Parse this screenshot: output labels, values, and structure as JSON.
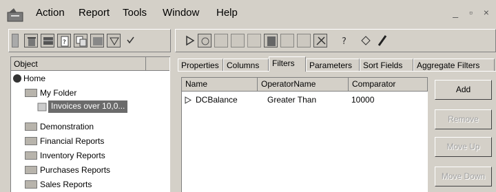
{
  "menu": {
    "items": [
      "Action",
      "Report",
      "Tools",
      "Window",
      "Help"
    ],
    "window_controls": "_ ▫ ×"
  },
  "object_panel": {
    "header": "Object",
    "tree": {
      "home": "Home",
      "my_folder": "My Folder",
      "selected_report": "Invoices over 10,0...",
      "folders": [
        "Demonstration",
        "Financial Reports",
        "Inventory Reports",
        "Purchases Reports",
        "Sales Reports"
      ]
    }
  },
  "tabs": [
    "Properties",
    "Columns",
    "Filters",
    "Parameters",
    "Sort Fields",
    "Aggregate Filters"
  ],
  "active_tab": "Filters",
  "filters": {
    "columns": [
      "Name",
      "OperatorName",
      "Comparator"
    ],
    "rows": [
      {
        "name": "DCBalance",
        "operator": "Greater Than",
        "comparator": "10000"
      }
    ]
  },
  "buttons": {
    "add": "Add",
    "remove": "Remove",
    "move_up": "Move Up",
    "move_down": "Move Down"
  }
}
